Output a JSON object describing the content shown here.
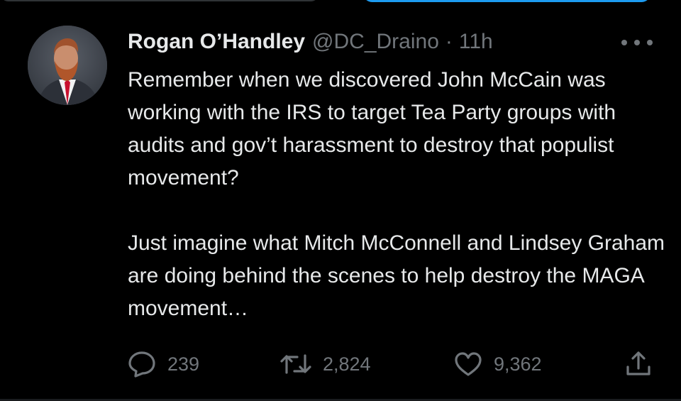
{
  "tweet": {
    "author": {
      "display_name": "Rogan O’Handley",
      "handle": "@DC_Draino",
      "avatar": "avatar-photo"
    },
    "separator": "·",
    "time": "11h",
    "paragraphs": [
      "Remember when we discovered John McCain was working with the IRS to target Tea Party groups with audits and gov’t harassment to destroy that populist movement?",
      "Just imagine what Mitch McConnell and Lindsey Graham are doing behind the scenes to help destroy the MAGA movement…"
    ],
    "actions": {
      "reply": {
        "icon": "reply-icon",
        "count": "239"
      },
      "retweet": {
        "icon": "retweet-icon",
        "count": "2,824"
      },
      "like": {
        "icon": "heart-icon",
        "count": "9,362"
      },
      "share": {
        "icon": "share-icon"
      }
    },
    "more_icon": "more-icon"
  },
  "colors": {
    "background": "#000000",
    "primary_text": "#e7e9ea",
    "secondary_text": "#71767b",
    "accent": "#1d9bf0"
  }
}
